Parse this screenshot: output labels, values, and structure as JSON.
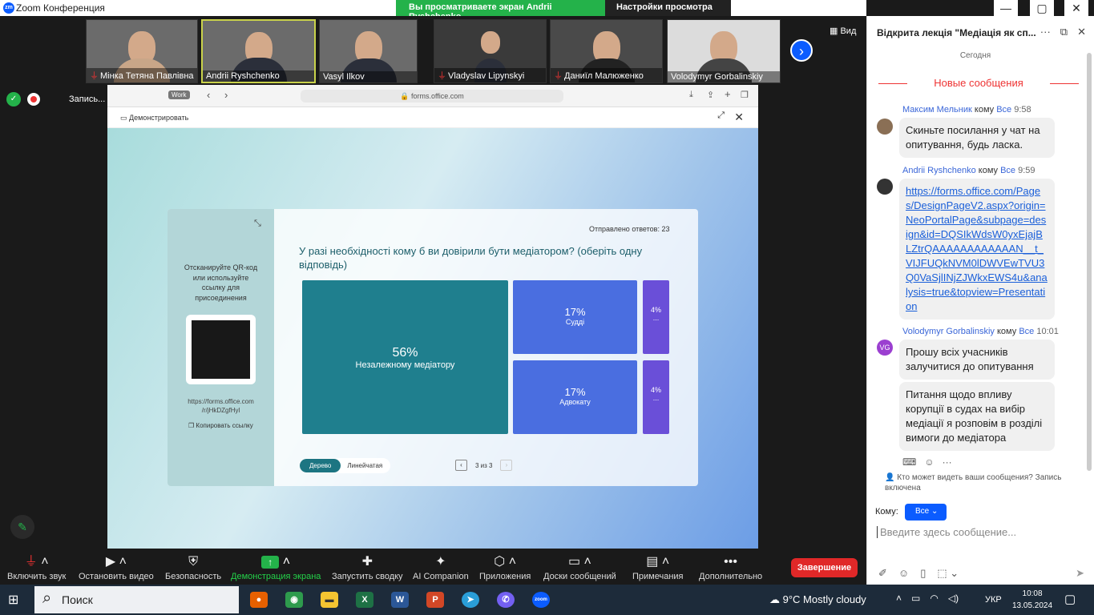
{
  "titlebar": {
    "app_title": "Zoom Конференция",
    "logo": "zm",
    "banner_viewing": "Вы просматриваете экран Andrii Ryshchenko",
    "banner_settings": "Настройки просмотра"
  },
  "participants": [
    {
      "name": "Мінка Тетяна Павлівна",
      "muted": true
    },
    {
      "name": "Andrii Ryshchenko",
      "muted": false
    },
    {
      "name": "Vasyl Ilkov",
      "muted": false
    },
    {
      "name": "Vladyslav Lipynskyi",
      "muted": true
    },
    {
      "name": "Даниїл Малюженко",
      "muted": true
    },
    {
      "name": "Volodymyr Gorbalinskiy",
      "muted": false
    }
  ],
  "view_label": "Вид",
  "recording": {
    "label": "Запись..."
  },
  "browser": {
    "workspace_tag": "Work",
    "url": "forms.office.com"
  },
  "presenter": {
    "label": "Демонстрировать"
  },
  "form": {
    "instructions": "Отсканируйте QR-код или используйте ссылку для присоединения",
    "link": "https://forms.office.com /r/jHkDZgfHyl",
    "copy_label": "Копировать ссылку",
    "answers_label": "Отправлено ответов: 23",
    "question": "У разі необхідності кому б ви довірили бути медіатором? (оберіть одну відповідь)",
    "toggle": [
      "Дерево",
      "Линейчатая"
    ],
    "pager": "3 из 3"
  },
  "chart_data": {
    "type": "treemap",
    "items": [
      {
        "label": "Незалежному медіатору",
        "value": 56,
        "display": "56%"
      },
      {
        "label": "Судді",
        "value": 17,
        "display": "17%"
      },
      {
        "label": "Адвокату",
        "value": 17,
        "display": "17%"
      },
      {
        "label": "...",
        "value": 4,
        "display": "4%"
      },
      {
        "label": "...",
        "value": 4,
        "display": "4%"
      }
    ],
    "unit": "%"
  },
  "toolbar": {
    "items": [
      "Включить звук",
      "Остановить видео",
      "Безопасность",
      "Демонстрация экрана",
      "Запустить сводку",
      "AI Companion",
      "Приложения",
      "Доски сообщений",
      "Примечания",
      "Дополнительно"
    ],
    "end": "Завершение"
  },
  "chat": {
    "title": "Відкрита лекція \"Медіація як сп...",
    "today": "Сегодня",
    "new_messages": "Новые сообщения",
    "messages": [
      {
        "sender": "Максим Мельник",
        "to_word": "кому",
        "audience": "Все",
        "time": "9:58",
        "text": "Скиньте посилання у чат на опитування, будь ласка."
      },
      {
        "sender": "Andrii Ryshchenko",
        "to_word": "кому",
        "audience": "Все",
        "time": "9:59",
        "text": "https://forms.office.com/Pages/DesignPageV2.aspx?origin=NeoPortalPage&subpage=design&id=DQSIkWdsW0yxEjajBLZtrQAAAAAAAAAAAAN__t_VIJFUQkNVM0lDWVEwTVU3Q0VaSjlINjZJWkxEWS4u&analysis=true&topview=Presentation"
      },
      {
        "sender": "Volodymyr Gorbalinskiy",
        "to_word": "кому",
        "audience": "Все",
        "time": "10:01",
        "avatar": "VG",
        "text": "Прошу всіх учасників залучитися до опитування"
      },
      {
        "text": "Питання щодо впливу корупції в судах на вибір медіації я розповім в розділі вимоги до медіатора"
      }
    ],
    "visibility_note": "Кто может видеть ваши сообщения? Запись включена",
    "to_label": "Кому:",
    "to_value": "Все",
    "input_placeholder": "Введите здесь сообщение..."
  },
  "taskbar": {
    "search": "Поиск",
    "weather": "9°C  Mostly cloudy",
    "lang": "УКР",
    "time": "10:08",
    "date": "13.05.2024"
  }
}
